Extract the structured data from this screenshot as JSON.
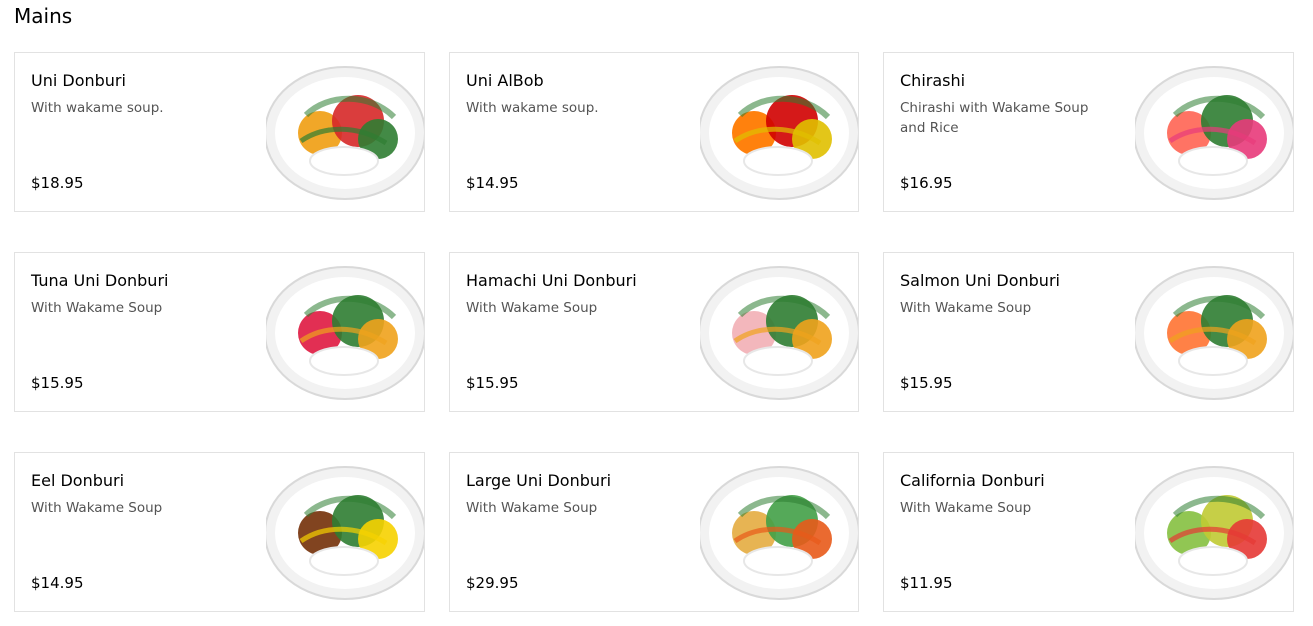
{
  "section": {
    "title": "Mains"
  },
  "items": [
    {
      "name": "Uni Donburi",
      "description": "With wakame soup.",
      "price": "$18.95",
      "image": "uni-donburi-bowl-icon",
      "accent_colors": [
        "#f0a21c",
        "#2f7d32",
        "#d62828"
      ]
    },
    {
      "name": "Uni AlBob",
      "description": "With wakame soup.",
      "price": "$14.95",
      "image": "uni-albob-bowl-icon",
      "accent_colors": [
        "#ff7a00",
        "#e0c000",
        "#d00000"
      ]
    },
    {
      "name": "Chirashi",
      "description": "Chirashi with Wakame Soup and Rice",
      "price": "$16.95",
      "image": "chirashi-bowl-icon",
      "accent_colors": [
        "#ff6b5c",
        "#e83a7a",
        "#2f7d32"
      ]
    },
    {
      "name": "Tuna Uni Donburi",
      "description": "With Wakame Soup",
      "price": "$15.95",
      "image": "tuna-uni-donburi-bowl-icon",
      "accent_colors": [
        "#e0244a",
        "#f0a21c",
        "#2f7d32"
      ]
    },
    {
      "name": "Hamachi Uni Donburi",
      "description": "With Wakame Soup",
      "price": "$15.95",
      "image": "hamachi-uni-donburi-bowl-icon",
      "accent_colors": [
        "#f2b3b8",
        "#f0a21c",
        "#2f7d32"
      ]
    },
    {
      "name": "Salmon Uni Donburi",
      "description": "With Wakame Soup",
      "price": "$15.95",
      "image": "salmon-uni-donburi-bowl-icon",
      "accent_colors": [
        "#ff7a3c",
        "#f0a21c",
        "#2f7d32"
      ]
    },
    {
      "name": "Eel Donburi",
      "description": "With Wakame Soup",
      "price": "$14.95",
      "image": "eel-donburi-bowl-icon",
      "accent_colors": [
        "#7a3a14",
        "#f6d100",
        "#2f7d32"
      ]
    },
    {
      "name": "Large Uni Donburi",
      "description": "With Wakame Soup",
      "price": "$29.95",
      "image": "large-uni-donburi-bowl-icon",
      "accent_colors": [
        "#e6b04a",
        "#e85a1a",
        "#43a047"
      ]
    },
    {
      "name": "California Donburi",
      "description": "With Wakame Soup",
      "price": "$11.95",
      "image": "california-donburi-bowl-icon",
      "accent_colors": [
        "#8bc34a",
        "#e53935",
        "#c0ca33"
      ]
    }
  ]
}
